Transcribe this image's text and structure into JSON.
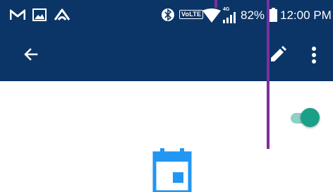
{
  "status_bar": {
    "left_icons": [
      "gmail-icon",
      "gallery-icon",
      "app-icon"
    ],
    "right_icons": [
      "bluetooth-icon",
      "wifi-icon",
      "signal-icon",
      "battery-icon"
    ],
    "volte_label": "VoLTE",
    "network_label": "4G",
    "battery_percent": "82%",
    "time": "12:00 PM"
  },
  "app_bar": {
    "back_icon": "arrow-back-icon",
    "edit_icon": "edit-pencil-icon",
    "more_icon": "more-vert-icon"
  },
  "content": {
    "toggle_state": "on",
    "calendar_icon": "calendar-icon"
  },
  "colors": {
    "app_bar": "#0b3566",
    "accent_teal": "#1aa089",
    "calendar_blue": "#2196f3",
    "overlay_purple": "#7b2fa0"
  }
}
